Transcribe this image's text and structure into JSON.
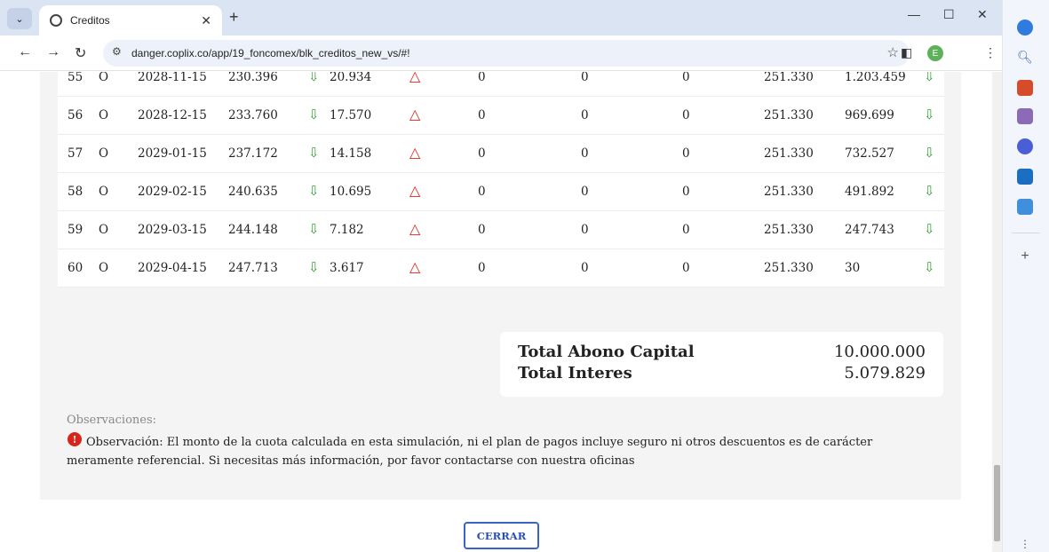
{
  "browser": {
    "tab_title": "Creditos",
    "url": "danger.coplix.co/app/19_foncomex/blk_creditos_new_vs/#!",
    "profile_initial": "E"
  },
  "table": {
    "rows": [
      {
        "num": "55",
        "flag": "O",
        "date": "2028-11-15",
        "capital": "230.396",
        "interest": "20.934",
        "c1": "0",
        "c2": "0",
        "c3": "0",
        "cuota": "251.330",
        "saldo": "1.203.459"
      },
      {
        "num": "56",
        "flag": "O",
        "date": "2028-12-15",
        "capital": "233.760",
        "interest": "17.570",
        "c1": "0",
        "c2": "0",
        "c3": "0",
        "cuota": "251.330",
        "saldo": "969.699"
      },
      {
        "num": "57",
        "flag": "O",
        "date": "2029-01-15",
        "capital": "237.172",
        "interest": "14.158",
        "c1": "0",
        "c2": "0",
        "c3": "0",
        "cuota": "251.330",
        "saldo": "732.527"
      },
      {
        "num": "58",
        "flag": "O",
        "date": "2029-02-15",
        "capital": "240.635",
        "interest": "10.695",
        "c1": "0",
        "c2": "0",
        "c3": "0",
        "cuota": "251.330",
        "saldo": "491.892"
      },
      {
        "num": "59",
        "flag": "O",
        "date": "2029-03-15",
        "capital": "244.148",
        "interest": "7.182",
        "c1": "0",
        "c2": "0",
        "c3": "0",
        "cuota": "251.330",
        "saldo": "247.743"
      },
      {
        "num": "60",
        "flag": "O",
        "date": "2029-04-15",
        "capital": "247.713",
        "interest": "3.617",
        "c1": "0",
        "c2": "0",
        "c3": "0",
        "cuota": "251.330",
        "saldo": "30"
      }
    ]
  },
  "totals": {
    "capital_label": "Total Abono Capital",
    "capital_value": "10.000.000",
    "interes_label": "Total Interes",
    "interes_value": "5.079.829"
  },
  "observaciones": {
    "title": "Observaciones:",
    "text": "Observación: El monto de la cuota calculada en esta simulación, ni el plan de pagos incluye seguro ni otros descuentos es de carácter meramente referencial. Si necesitas más información, por favor contactarse con nuestra oficinas"
  },
  "buttons": {
    "close_label": "CERRAR"
  },
  "colors": {
    "arrow": "#2e9e2e",
    "warning": "#e0261c",
    "button_border": "#3b63c4"
  },
  "icons": [
    "tab-dropdown-icon",
    "globe-icon",
    "close-icon",
    "new-tab-icon",
    "back-icon",
    "forward-icon",
    "reload-icon",
    "site-settings-icon",
    "star-icon",
    "side-panel-icon",
    "menu-icon",
    "arrow-down-icon",
    "warning-triangle-icon",
    "info-icon"
  ]
}
